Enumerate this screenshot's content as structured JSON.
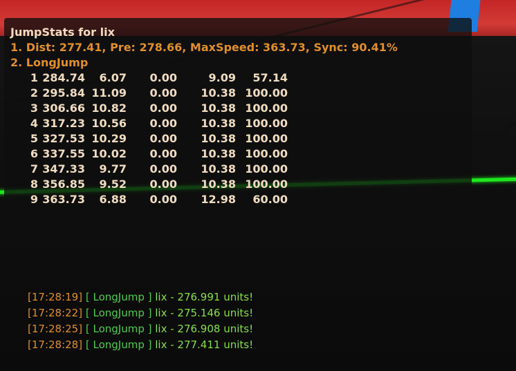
{
  "jumpstats": {
    "title": "JumpStats for lix",
    "summary": "1. Dist: 277.41, Pre: 278.66, MaxSpeed: 363.73, Sync: 90.41%",
    "jump_type": "2. LongJump",
    "rows": [
      [
        "1",
        "284.74",
        "6.07",
        "0.00",
        "9.09",
        "57.14"
      ],
      [
        "2",
        "295.84",
        "11.09",
        "0.00",
        "10.38",
        "100.00"
      ],
      [
        "3",
        "306.66",
        "10.82",
        "0.00",
        "10.38",
        "100.00"
      ],
      [
        "4",
        "317.23",
        "10.56",
        "0.00",
        "10.38",
        "100.00"
      ],
      [
        "5",
        "327.53",
        "10.29",
        "0.00",
        "10.38",
        "100.00"
      ],
      [
        "6",
        "337.55",
        "10.02",
        "0.00",
        "10.38",
        "100.00"
      ],
      [
        "7",
        "347.33",
        "9.77",
        "0.00",
        "10.38",
        "100.00"
      ],
      [
        "8",
        "356.85",
        "9.52",
        "0.00",
        "10.38",
        "100.00"
      ],
      [
        "9",
        "363.73",
        "6.88",
        "0.00",
        "12.98",
        "60.00"
      ]
    ]
  },
  "chat": [
    {
      "time": "[17:28:19]",
      "tag": "[ LongJump ]",
      "rest": "lix - 276.991 units!"
    },
    {
      "time": "[17:28:22]",
      "tag": "[ LongJump ]",
      "rest": "lix - 275.146 units!"
    },
    {
      "time": "[17:28:25]",
      "tag": "[ LongJump ]",
      "rest": "lix - 276.908 units!"
    },
    {
      "time": "[17:28:28]",
      "tag": "[ LongJump ]",
      "rest": "lix - 277.411 units!"
    }
  ],
  "colors": {
    "title": "#f0dcc0",
    "summary": "#e08f2a",
    "chat_time": "#e08f2a",
    "chat_tag": "#4dcc4d",
    "chat_text": "#86e045",
    "laser": "#1ee81e",
    "sky": "#c42626",
    "post": "#1e7fe0"
  }
}
